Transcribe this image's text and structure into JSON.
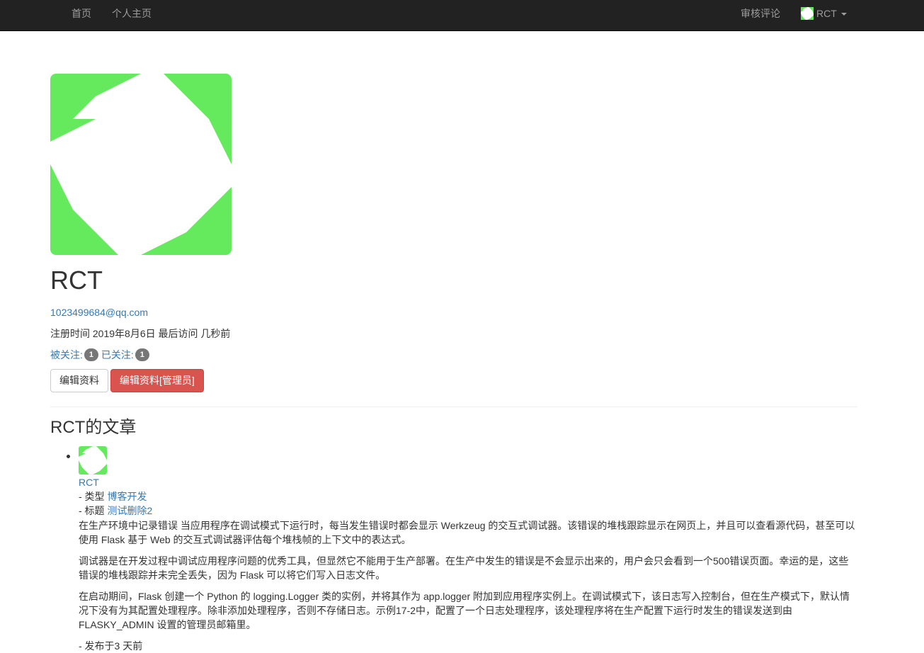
{
  "navbar": {
    "home": "首页",
    "profile": "个人主页",
    "moderate": "审核评论",
    "user": "RCT"
  },
  "profile": {
    "username": "RCT",
    "email": "1023499684@qq.com",
    "member_since_label": "注册时间",
    "member_since": "2019年8月6日",
    "last_seen_label": "最后访问",
    "last_seen": "几秒前",
    "followers_label": "被关注:",
    "followers_count": "1",
    "following_label": "已关注:",
    "following_count": "1",
    "edit_button": "编辑资料",
    "admin_edit_button": "编辑资料[管理员]"
  },
  "posts_section": {
    "heading": "RCT的文章"
  },
  "post": {
    "author": "RCT",
    "category_prefix": "- 类型",
    "category": "博客开发",
    "title_prefix": "- 标题",
    "title": "测试删除2",
    "paragraphs": [
      "在生产环境中记录错误 当应用程序在调试模式下运行时，每当发生错误时都会显示 Werkzeug 的交互式调试器。该错误的堆栈跟踪显示在网页上，并且可以查看源代码，甚至可以使用 Flask 基于 Web 的交互式调试器评估每个堆栈帧的上下文中的表达式。",
      "调试器是在开发过程中调试应用程序问题的优秀工具，但显然它不能用于生产部署。在生产中发生的错误是不会显示出来的，用户会只会看到一个500错误页面。幸运的是，这些错误的堆栈跟踪并未完全丢失，因为 Flask 可以将它们写入日志文件。",
      "在启动期间，Flask 创建一个 Python 的 logging.Logger 类的实例，并将其作为 app.logger 附加到应用程序实例上。在调试模式下，该日志写入控制台，但在生产模式下，默认情况下没有为其配置处理程序。除非添加处理程序，否则不存储日志。示例17-2中，配置了一个日志处理程序，该处理程序将在生产配置下运行时发生的错误发送到由 FLASKY_ADMIN 设置的管理员邮箱里。"
    ],
    "published": "- 发布于3 天前"
  },
  "colors": {
    "navbar_bg": "#222222",
    "identicon": "#66ea5d",
    "link": "#337ab7",
    "danger": "#d9534f"
  }
}
